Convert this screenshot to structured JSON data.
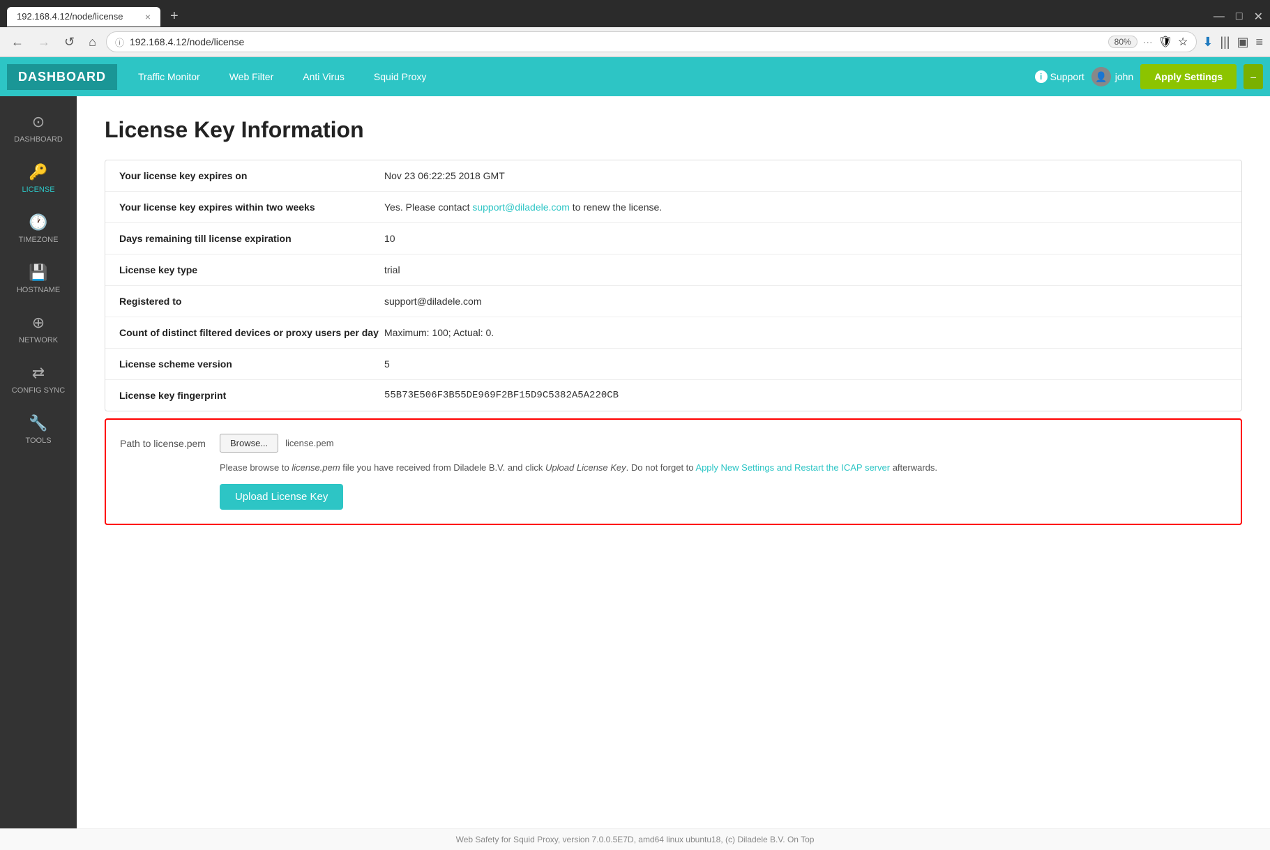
{
  "browser": {
    "tab_title": "192.168.4.12/node/license",
    "tab_close": "×",
    "tab_new": "+",
    "window_minimize": "—",
    "window_restore": "□",
    "window_close": "✕",
    "url": "192.168.4.12/node/license",
    "zoom": "80%",
    "nav_back": "←",
    "nav_forward": "→",
    "nav_reload": "↺",
    "nav_home": "⌂",
    "toolbar_more": "···",
    "toolbar_shield": "🛡",
    "toolbar_star": "☆",
    "toolbar_download": "⬇",
    "toolbar_books": "|||",
    "toolbar_layout": "▣",
    "toolbar_menu": "≡"
  },
  "nav": {
    "logo": "DASHBOARD",
    "links": [
      {
        "label": "Traffic Monitor"
      },
      {
        "label": "Web Filter"
      },
      {
        "label": "Anti Virus"
      },
      {
        "label": "Squid Proxy"
      }
    ],
    "support_label": "Support",
    "user_name": "john",
    "apply_settings_label": "Apply Settings",
    "apply_settings_minus": "–"
  },
  "sidebar": {
    "items": [
      {
        "id": "dashboard",
        "label": "DASHBOARD",
        "icon": "⊙"
      },
      {
        "id": "license",
        "label": "LICENSE",
        "icon": "🔑",
        "active": true
      },
      {
        "id": "timezone",
        "label": "TIMEZONE",
        "icon": "🕐"
      },
      {
        "id": "hostname",
        "label": "HOSTNAME",
        "icon": "💾"
      },
      {
        "id": "network",
        "label": "NETWORK",
        "icon": "⊕"
      },
      {
        "id": "config-sync",
        "label": "CONFIG SYNC",
        "icon": "⇄"
      },
      {
        "id": "tools",
        "label": "TOOLS",
        "icon": "🔧"
      }
    ]
  },
  "page": {
    "title": "License Key Information",
    "rows": [
      {
        "label": "Your license key expires on",
        "value": "Nov 23 06:22:25 2018 GMT",
        "link": null
      },
      {
        "label": "Your license key expires within two weeks",
        "value_prefix": "Yes. Please contact ",
        "link_text": "support@diladele.com",
        "link_href": "mailto:support@diladele.com",
        "value_suffix": " to renew the license.",
        "has_link": true
      },
      {
        "label": "Days remaining till license expiration",
        "value": "10",
        "link": null
      },
      {
        "label": "License key type",
        "value": "trial",
        "link": null
      },
      {
        "label": "Registered to",
        "value": "support@diladele.com",
        "link": null
      },
      {
        "label": "Count of distinct filtered devices or proxy users per day",
        "value": "Maximum: 100; Actual: 0.",
        "link": null
      },
      {
        "label": "License scheme version",
        "value": "5",
        "link": null
      },
      {
        "label": "License key fingerprint",
        "value": "55B73E506F3B55DE969F2BF15D9C5382A5A220CB",
        "link": null
      }
    ],
    "upload": {
      "path_label": "Path to license.pem",
      "browse_btn": "Browse...",
      "file_name": "license.pem",
      "help_text_before": "Please browse to ",
      "help_italic": "license.pem",
      "help_text_middle": " file you have received from Diladele B.V. and click ",
      "help_italic2": "Upload License Key",
      "help_text_after": ". Do not forget to ",
      "help_link_text": "Apply New Settings and Restart the ICAP server",
      "help_link_after": " afterwards.",
      "upload_btn": "Upload License Key"
    }
  },
  "footer": {
    "text": "Web Safety for Squid Proxy, version 7.0.0.5E7D, amd64 linux ubuntu18, (c) Diladele B.V.   On Top"
  }
}
